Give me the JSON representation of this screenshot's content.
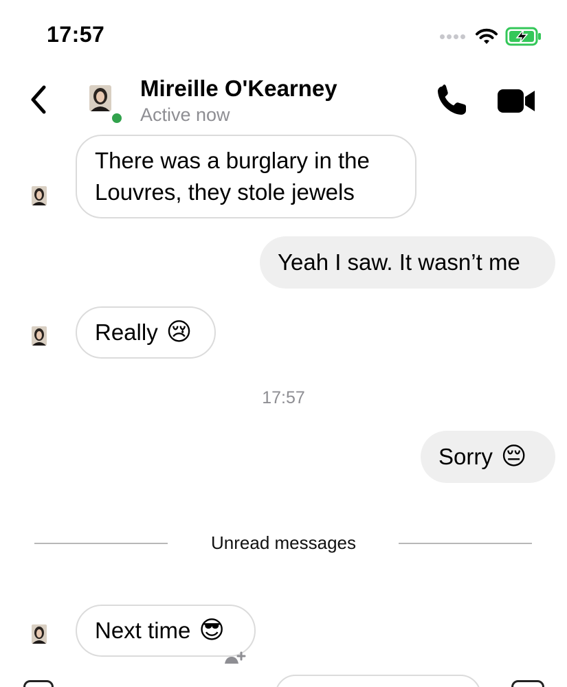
{
  "status_bar": {
    "time": "17:57"
  },
  "header": {
    "contact_name": "Mireille O'Kearney",
    "presence": "Active now",
    "presence_color": "#31a24c"
  },
  "messages": [
    {
      "direction": "incoming",
      "text": "There was a burglary in the Louvres, they stole jewels",
      "emoji": ""
    },
    {
      "direction": "outgoing",
      "text": "Yeah I saw. It wasn’t me",
      "emoji": ""
    },
    {
      "direction": "incoming",
      "text": "Really",
      "emoji": "😢"
    },
    {
      "direction": "outgoing",
      "text": "Sorry",
      "emoji": "😔"
    },
    {
      "direction": "incoming",
      "text": "Next time",
      "emoji": "😎"
    }
  ],
  "timestamp_separator": "17:57",
  "unread_divider": "Unread messages",
  "icons": {
    "back": "chevron-left-icon",
    "call": "phone-icon",
    "video": "video-camera-icon",
    "wifi": "wifi-icon",
    "battery": "battery-charging-icon",
    "react": "add-reaction-icon"
  },
  "colors": {
    "incoming_bubble_border": "#dbdbdb",
    "outgoing_bubble_bg": "#efefef",
    "battery_fill": "#34c759"
  }
}
